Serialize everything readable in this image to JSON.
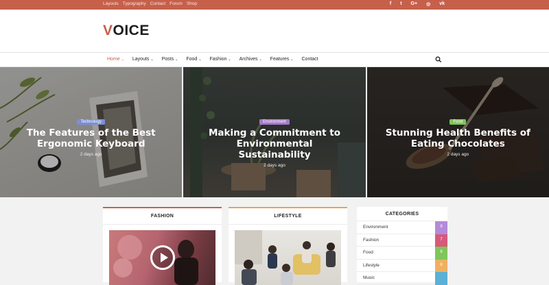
{
  "topbar": {
    "links": [
      "Layouts",
      "Typography",
      "Contact",
      "Forum",
      "Shop"
    ],
    "social_icons": [
      "facebook-icon",
      "twitter-icon",
      "google-plus-icon",
      "instagram-icon",
      "vk-icon"
    ],
    "social_glyphs": [
      "f",
      "t",
      "G+",
      "◎",
      "vk"
    ]
  },
  "logo": {
    "first": "V",
    "rest": "OICE"
  },
  "nav": {
    "items": [
      {
        "label": "Home",
        "dropdown": true
      },
      {
        "label": "Layouts",
        "dropdown": true
      },
      {
        "label": "Posts",
        "dropdown": true
      },
      {
        "label": "Food",
        "dropdown": true
      },
      {
        "label": "Fashion",
        "dropdown": true
      },
      {
        "label": "Archives",
        "dropdown": true
      },
      {
        "label": "Features",
        "dropdown": true
      },
      {
        "label": "Contact",
        "dropdown": false
      }
    ],
    "active": "Home"
  },
  "slides": [
    {
      "tag": "Technology",
      "tag_color": "#7b8ed6",
      "title": "The Features of the Best Ergonomic Keyboard",
      "date": "2 days ago"
    },
    {
      "tag": "Environment",
      "tag_color": "#a77ac7",
      "title": "Making a Commitment to Environmental Sustainability",
      "date": "2 days ago"
    },
    {
      "tag": "Food",
      "tag_color": "#7ec65b",
      "title": "Stunning Health Benefits of Eating Chocolates",
      "date": "2 days ago"
    }
  ],
  "widgets": {
    "fashion": {
      "title": "FASHION",
      "accent": "#c6604b"
    },
    "lifestyle": {
      "title": "LIFESTYLE",
      "accent": "#e6a25a"
    },
    "categories": {
      "title": "CATEGORIES",
      "items": [
        {
          "label": "Environment",
          "count": "9",
          "color": "#b48ad9"
        },
        {
          "label": "Fashion",
          "count": "7",
          "color": "#d65a7a"
        },
        {
          "label": "Food",
          "count": "8",
          "color": "#7ec65b"
        },
        {
          "label": "Lifestyle",
          "count": "8",
          "color": "#f0b060"
        },
        {
          "label": "Music",
          "count": "",
          "color": "#5ab0d6"
        }
      ]
    }
  }
}
